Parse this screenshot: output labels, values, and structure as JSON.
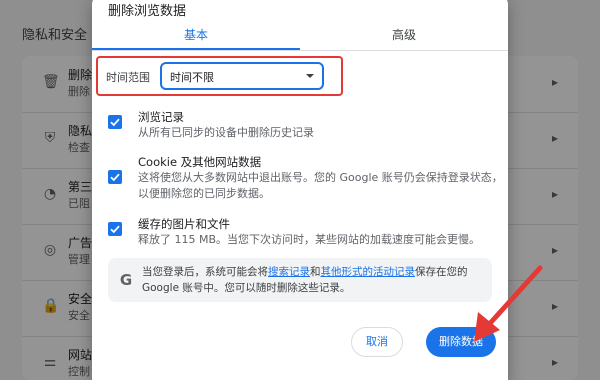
{
  "background": {
    "section_title": "隐私和安全",
    "rows": [
      {
        "icon": "trash-icon",
        "glyph": "🗑",
        "line1": "删除",
        "line2": "删除"
      },
      {
        "icon": "shield-check-icon",
        "glyph": "⛨",
        "line1": "隐私",
        "line2": "检查"
      },
      {
        "icon": "cookie-icon",
        "glyph": "◔",
        "line1": "第三",
        "line2": "已阻"
      },
      {
        "icon": "ad-privacy-icon",
        "glyph": "◎",
        "line1": "广告",
        "line2": "管理"
      },
      {
        "icon": "lock-icon",
        "glyph": "🔒",
        "line1": "安全",
        "line2": "安全"
      },
      {
        "icon": "sliders-icon",
        "glyph": "⚌",
        "line1": "网站",
        "line2": "控制"
      }
    ]
  },
  "dialog": {
    "title": "删除浏览数据",
    "tabs": {
      "basic": "基本",
      "advanced": "高级",
      "active": "basic"
    },
    "time_range": {
      "label": "时间范围",
      "value": "时间不限"
    },
    "options": [
      {
        "title": "浏览记录",
        "desc": "从所有已同步的设备中删除历史记录",
        "checked": true
      },
      {
        "title": "Cookie 及其他网站数据",
        "desc": "这将使您从大多数网站中退出账号。您的 Google 账号仍会保持登录状态，以便删除您的已同步数据。",
        "checked": true
      },
      {
        "title": "缓存的图片和文件",
        "desc": "释放了 115 MB。当您下次访问时，某些网站的加载速度可能会更慢。",
        "checked": true
      }
    ],
    "info": {
      "text_before": "当您登录后，系统可能会将",
      "link1": "搜索记录",
      "text_mid": "和",
      "link2": "其他形式的活动记录",
      "text_after": "保存在您的 Google 账号中。您可以随时删除这些记录。"
    },
    "buttons": {
      "cancel": "取消",
      "delete": "删除数据"
    }
  },
  "colors": {
    "accent": "#1a73e8",
    "highlight_box": "#e53935",
    "annotation_arrow": "#e53935"
  }
}
